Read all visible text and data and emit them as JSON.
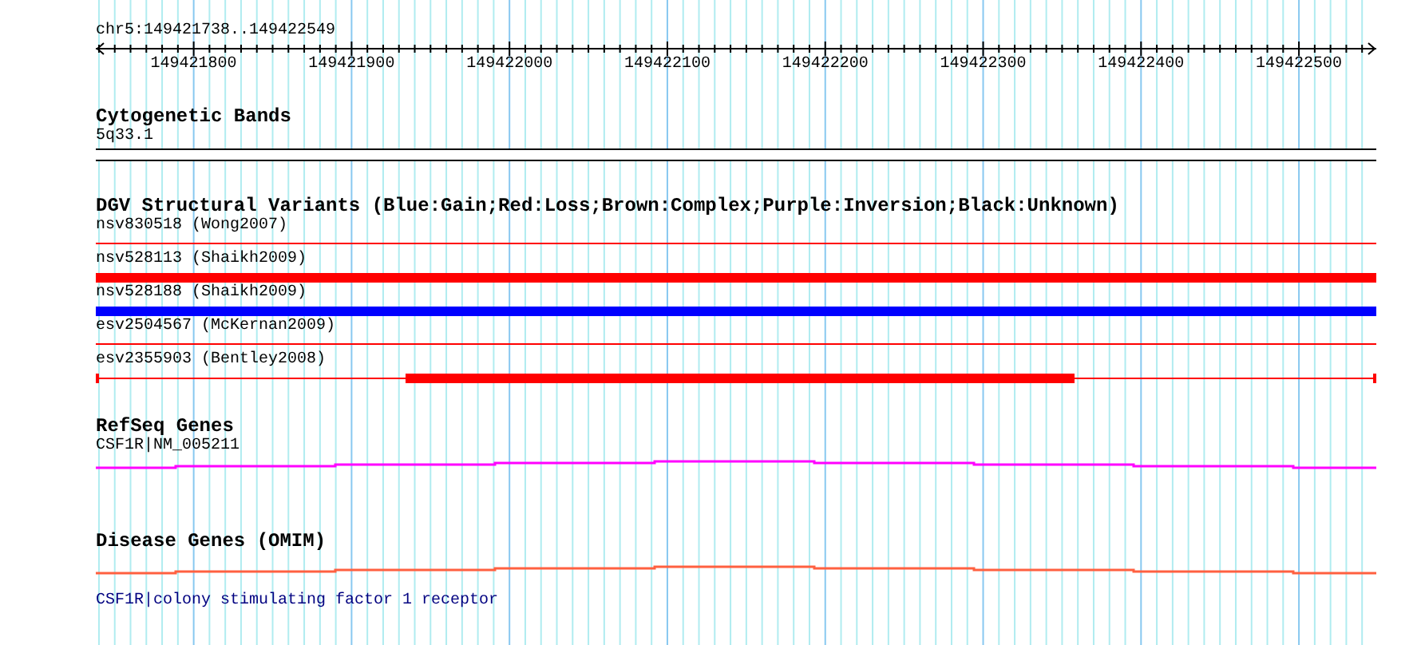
{
  "ruler": {
    "location": "chr5:149421738..149422549",
    "tick_labels": [
      "149421800",
      "149421900",
      "149422000",
      "149422100",
      "149422200",
      "149422300",
      "149422400",
      "149422500"
    ]
  },
  "tracks": [
    {
      "kind": "bands",
      "title": "Cytogenetic Bands",
      "features": [
        {
          "label": "5q33.1"
        }
      ]
    },
    {
      "kind": "variants",
      "title": "DGV Structural Variants (Blue:Gain;Red:Loss;Brown:Complex;Purple:Inversion;Black:Unknown)",
      "features": [
        {
          "label": "nsv830518 (Wong2007)",
          "kind": "thin",
          "color": "#ff0000"
        },
        {
          "label": "nsv528113 (Shaikh2009)",
          "kind": "thick",
          "color": "#ff0000"
        },
        {
          "label": "nsv528188 (Shaikh2009)",
          "kind": "thick",
          "color": "#0000ff"
        },
        {
          "label": "esv2504567 (McKernan2009)",
          "kind": "thin",
          "color": "#ff0000"
        },
        {
          "label": "esv2355903 (Bentley2008)",
          "kind": "partial",
          "color": "#ff0000"
        }
      ]
    },
    {
      "kind": "gene",
      "title": "RefSeq Genes",
      "features": [
        {
          "label": "CSF1R|NM_005211",
          "color": "#ff00ff"
        }
      ]
    },
    {
      "kind": "disease",
      "title": "Disease Genes (OMIM)",
      "features": [
        {
          "label": "CSF1R|colony stimulating factor 1 receptor",
          "color": "#ff6040"
        }
      ]
    }
  ]
}
